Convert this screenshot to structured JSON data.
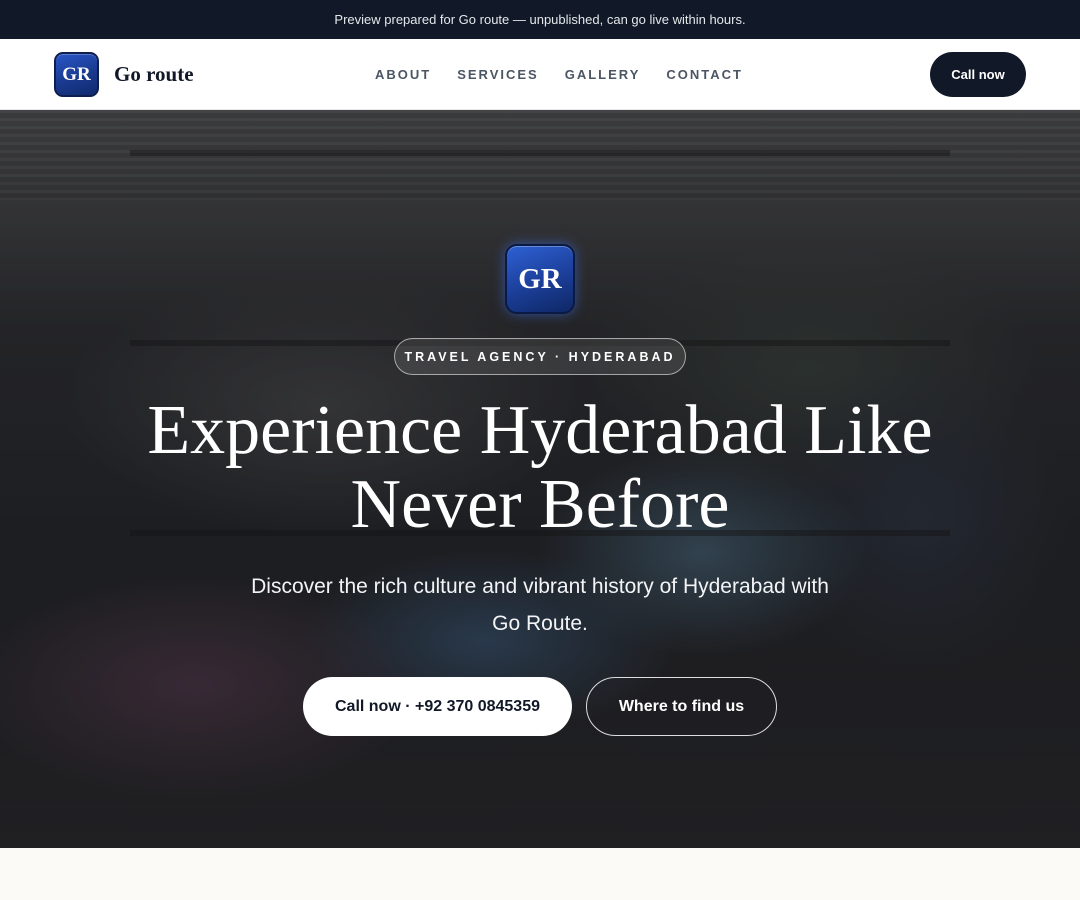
{
  "banner": {
    "text": "Preview prepared for Go route — unpublished, can go live within hours."
  },
  "header": {
    "logo_text": "GR",
    "brand_name": "Go route",
    "nav": [
      {
        "label": "ABOUT"
      },
      {
        "label": "SERVICES"
      },
      {
        "label": "GALLERY"
      },
      {
        "label": "CONTACT"
      }
    ],
    "cta_label": "Call now"
  },
  "hero": {
    "logo_text": "GR",
    "tagline": "TRAVEL AGENCY · HYDERABAD",
    "headline_line1": "Experience Hyderabad Like",
    "headline_line2": "Never Before",
    "subhead_line1": "Discover the rich culture and vibrant history of Hyderabad with",
    "subhead_line2": "Go Route.",
    "primary_button": "Call now · +92 370 0845359",
    "secondary_button": "Where to find us"
  },
  "colors": {
    "banner_bg": "#111827",
    "brand_blue": "#1a3a8f",
    "dark": "#111827",
    "page_bg": "#fbfaf7"
  }
}
